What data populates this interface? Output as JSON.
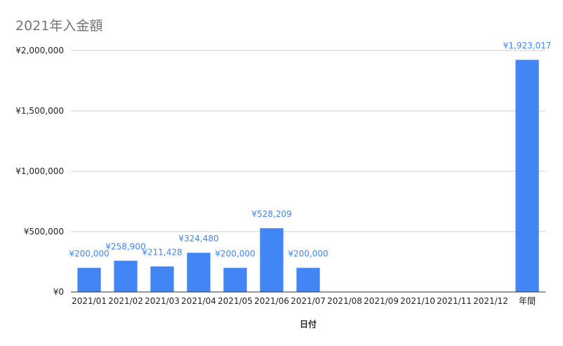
{
  "chart_data": {
    "type": "bar",
    "title": "2021年入金額",
    "xlabel": "日付",
    "ylabel": "",
    "categories": [
      "2021/01",
      "2021/02",
      "2021/03",
      "2021/04",
      "2021/05",
      "2021/06",
      "2021/07",
      "2021/08",
      "2021/09",
      "2021/10",
      "2021/11",
      "2021/12",
      "年間"
    ],
    "series": [
      {
        "values": [
          200000,
          258900,
          211428,
          324480,
          200000,
          528209,
          200000,
          null,
          null,
          null,
          null,
          null,
          1923017
        ],
        "labels": [
          "¥200,000",
          "¥258,900",
          "¥211,428",
          "¥324,480",
          "¥200,000",
          "¥528,209",
          "¥200,000",
          "",
          "",
          "",
          "",
          "",
          "¥1,923,017"
        ],
        "color": "#4285f4"
      }
    ],
    "ylim": [
      0,
      2000000
    ],
    "yticks": [
      0,
      500000,
      1000000,
      1500000,
      2000000
    ],
    "ytick_labels": [
      "¥0",
      "¥500,000",
      "¥1,000,000",
      "¥1,500,000",
      "¥2,000,000"
    ],
    "grid": true,
    "legend": "none"
  }
}
